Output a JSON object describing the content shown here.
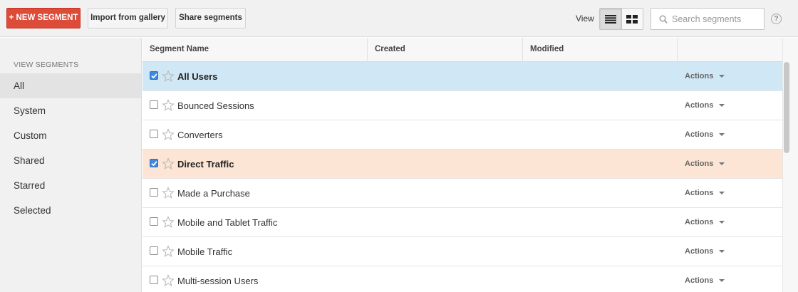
{
  "toolbar": {
    "new_segment_label": "+ NEW SEGMENT",
    "import_label": "Import from gallery",
    "share_label": "Share segments",
    "view_label": "View",
    "view_modes": [
      "list-view",
      "grid-view"
    ],
    "active_view": "list-view",
    "search_placeholder": "Search segments",
    "help_label": "?",
    "accent_color": "#dd4b39"
  },
  "sidebar": {
    "title": "VIEW SEGMENTS",
    "items": [
      {
        "label": "All",
        "active": true
      },
      {
        "label": "System",
        "active": false
      },
      {
        "label": "Custom",
        "active": false
      },
      {
        "label": "Shared",
        "active": false
      },
      {
        "label": "Starred",
        "active": false
      },
      {
        "label": "Selected",
        "active": false
      }
    ]
  },
  "table": {
    "columns": [
      "Segment Name",
      "Created",
      "Modified",
      ""
    ],
    "rows": [
      {
        "name": "All Users",
        "checked": true,
        "starred": false,
        "created": "",
        "modified": "",
        "actions_label": "Actions",
        "highlight": "#d0e8f5"
      },
      {
        "name": "Bounced Sessions",
        "checked": false,
        "starred": false,
        "created": "",
        "modified": "",
        "actions_label": "Actions",
        "highlight": ""
      },
      {
        "name": "Converters",
        "checked": false,
        "starred": false,
        "created": "",
        "modified": "",
        "actions_label": "Actions",
        "highlight": ""
      },
      {
        "name": "Direct Traffic",
        "checked": true,
        "starred": false,
        "created": "",
        "modified": "",
        "actions_label": "Actions",
        "highlight": "#fce5d4"
      },
      {
        "name": "Made a Purchase",
        "checked": false,
        "starred": false,
        "created": "",
        "modified": "",
        "actions_label": "Actions",
        "highlight": ""
      },
      {
        "name": "Mobile and Tablet Traffic",
        "checked": false,
        "starred": false,
        "created": "",
        "modified": "",
        "actions_label": "Actions",
        "highlight": ""
      },
      {
        "name": "Mobile Traffic",
        "checked": false,
        "starred": false,
        "created": "",
        "modified": "",
        "actions_label": "Actions",
        "highlight": ""
      },
      {
        "name": "Multi-session Users",
        "checked": false,
        "starred": false,
        "created": "",
        "modified": "",
        "actions_label": "Actions",
        "highlight": ""
      }
    ]
  }
}
